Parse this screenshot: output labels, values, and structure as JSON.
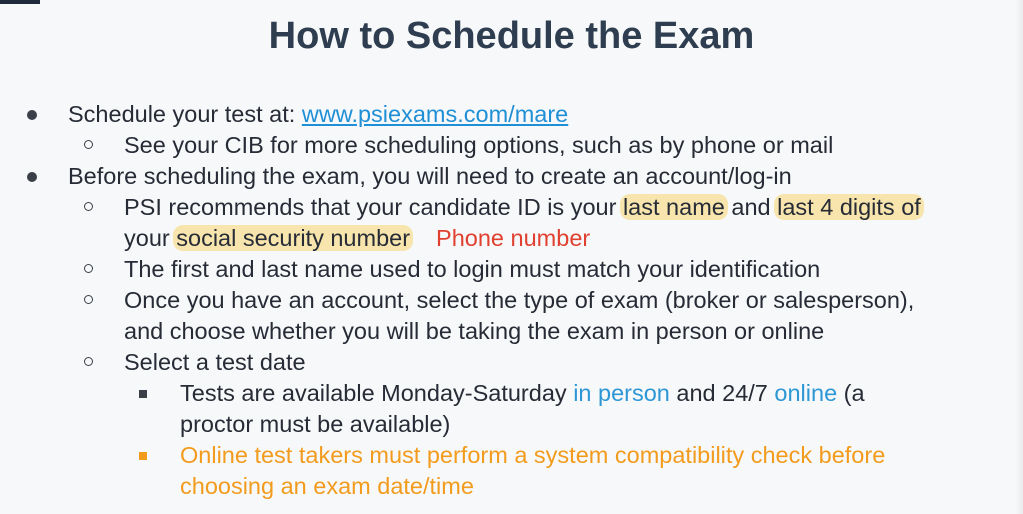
{
  "slide": {
    "title": "How to Schedule the Exam"
  },
  "bullets": {
    "b1_text": "Schedule your test at: ",
    "b1_link": "www.psiexams.com/mare",
    "b1_sub1": "See your CIB for more scheduling options, such as by phone or mail",
    "b2_text": "Before scheduling the exam, you will need to create an account/log-in",
    "b2_sub1_a": "PSI recommends that your candidate ID is your ",
    "b2_sub1_hl1": "last name",
    "b2_sub1_and": " and ",
    "b2_sub1_hl2": "last 4 digits of",
    "b2_sub1_your": "your ",
    "b2_sub1_hl3": "social security number",
    "b2_sub1_note": "Phone number",
    "b2_sub2": "The first and last name used to login must match your identification",
    "b2_sub3_l1": "Once you have an account, select the type of exam (broker or salesperson),",
    "b2_sub3_l2": "and choose whether you will be taking the exam in person or online",
    "b2_sub4": "Select a test date",
    "b2_sub4_sq1_a": "Tests are available Monday-Saturday ",
    "b2_sub4_sq1_inperson": "in person",
    "b2_sub4_sq1_mid": " and 24/7 ",
    "b2_sub4_sq1_online": "online",
    "b2_sub4_sq1_end": " (a",
    "b2_sub4_sq1_l2": "proctor must be available)",
    "b2_sub4_sq2_l1": "Online test takers must perform a system compatibility check before",
    "b2_sub4_sq2_l2": "choosing an exam date/time"
  },
  "colors": {
    "title": "#2e3d4f",
    "link": "#1f8fd6",
    "blue_text": "#2d97d6",
    "red_note": "#e0402f",
    "orange_text": "#f29b1d",
    "highlight": "#f8d670"
  }
}
